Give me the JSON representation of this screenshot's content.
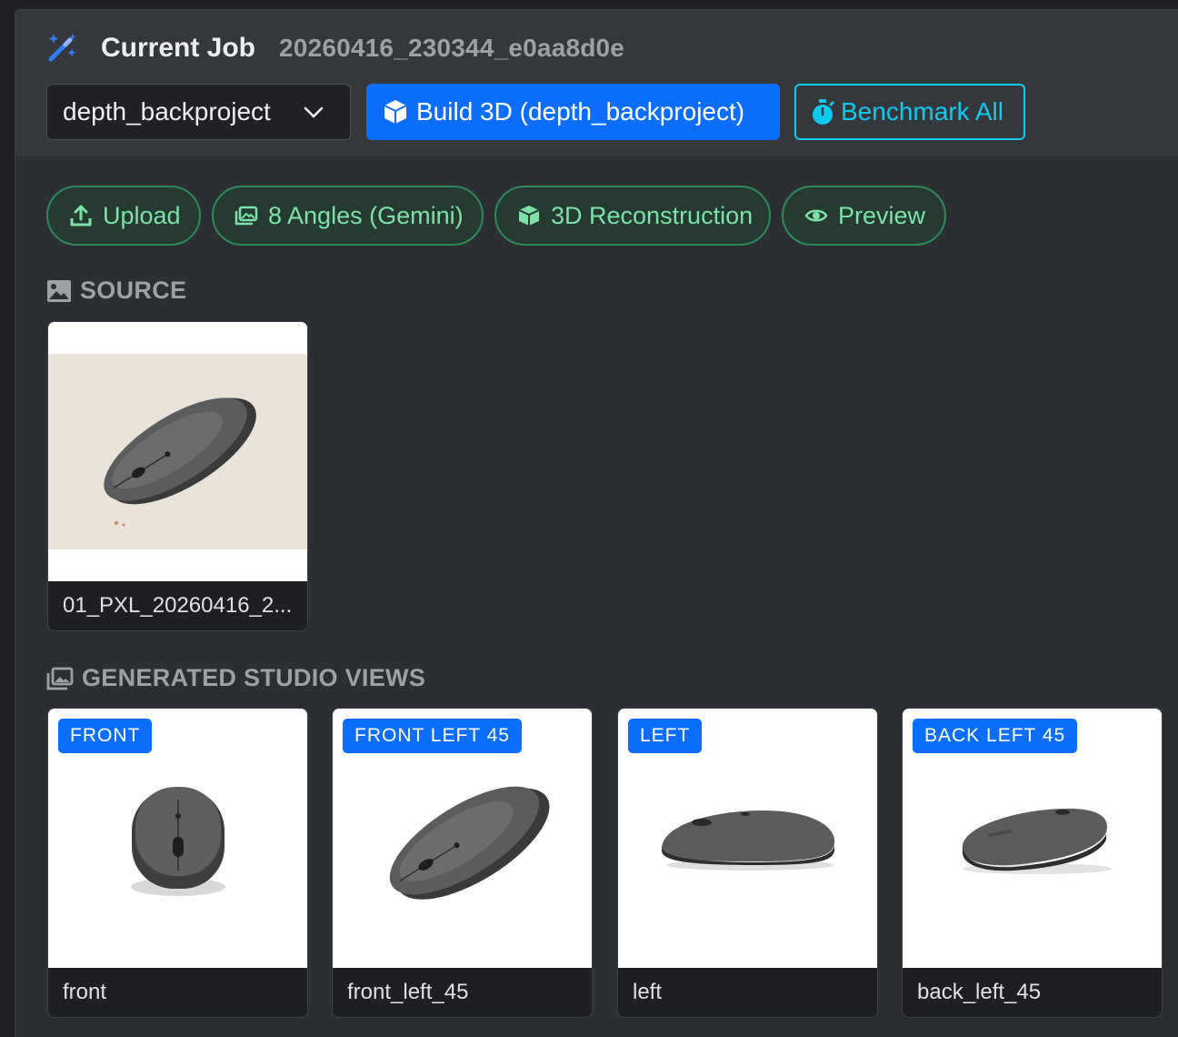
{
  "header": {
    "title": "Current Job",
    "job_id": "20260416_230344_e0aa8d0e",
    "method_select": {
      "value": "depth_backproject"
    },
    "build_button": "Build 3D (depth_backproject)",
    "benchmark_button": "Benchmark All"
  },
  "steps": [
    {
      "label": "Upload",
      "icon": "upload-icon"
    },
    {
      "label": "8 Angles (Gemini)",
      "icon": "images-icon"
    },
    {
      "label": "3D Reconstruction",
      "icon": "box-icon"
    },
    {
      "label": "Preview",
      "icon": "eye-icon"
    }
  ],
  "source": {
    "heading": "SOURCE",
    "items": [
      {
        "caption": "01_PXL_20260416_2..."
      }
    ]
  },
  "generated": {
    "heading": "GENERATED STUDIO VIEWS",
    "items": [
      {
        "badge": "FRONT",
        "caption": "front"
      },
      {
        "badge": "FRONT LEFT 45",
        "caption": "front_left_45"
      },
      {
        "badge": "LEFT",
        "caption": "left"
      },
      {
        "badge": "BACK LEFT 45",
        "caption": "back_left_45"
      }
    ]
  },
  "colors": {
    "primary": "#0d6efd",
    "info": "#0dcaf0",
    "success_text": "#7ee2a8",
    "success_border": "#2d8a5a"
  }
}
